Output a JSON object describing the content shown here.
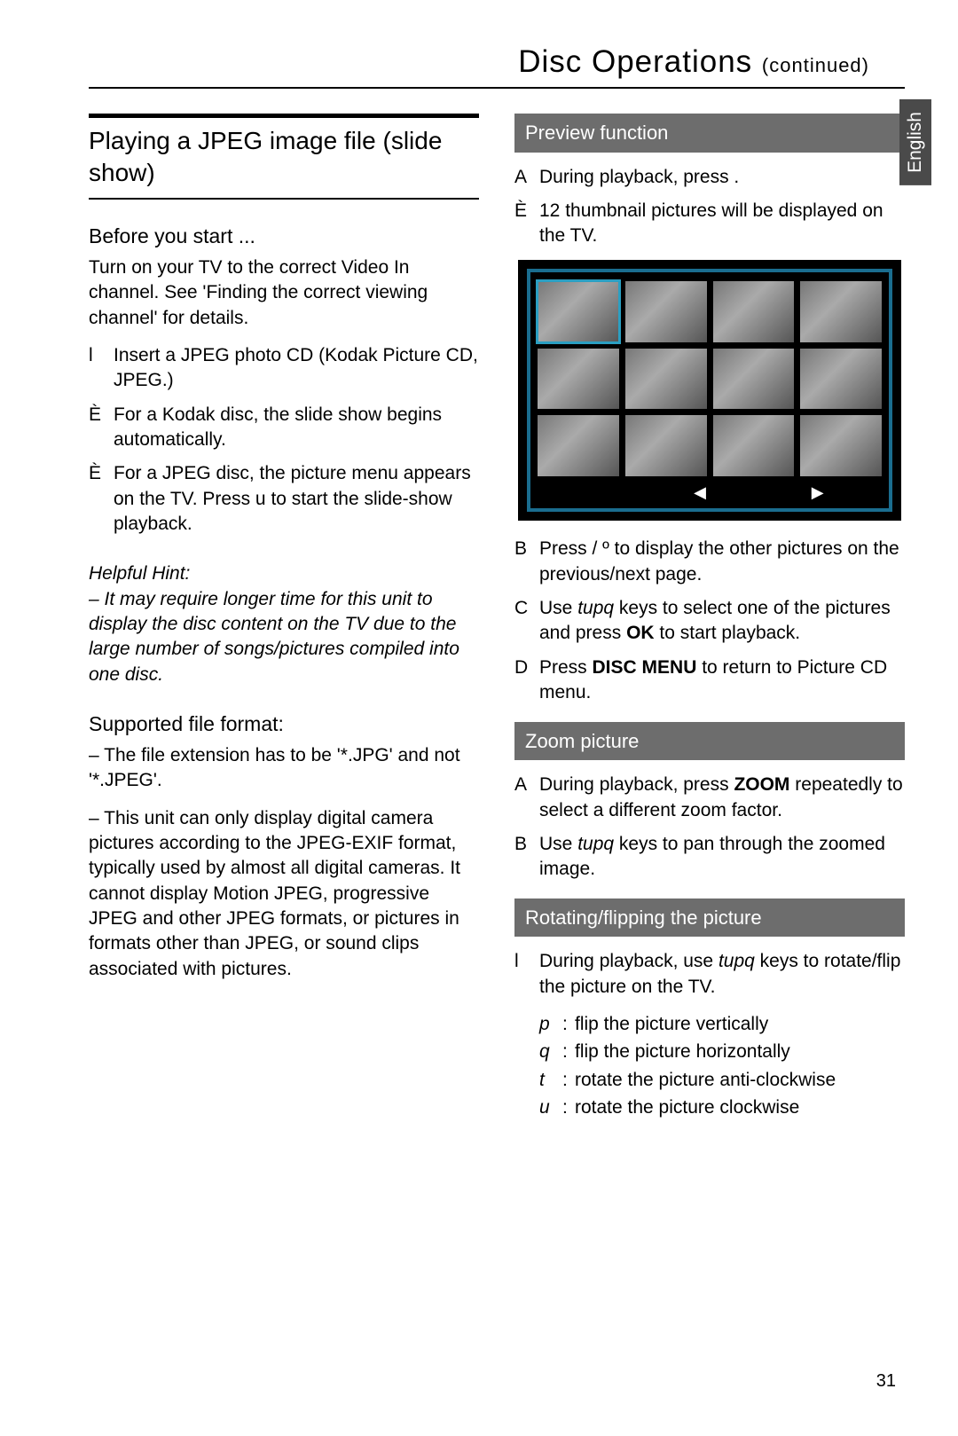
{
  "header": {
    "main": "Disc Operations ",
    "sub": "(continued)"
  },
  "lang": "English",
  "left": {
    "title": "Playing a JPEG image ﬁle (slide show)",
    "before_head": "Before you start ...",
    "before_body": "Turn on your TV to the correct Video In channel. See 'Finding the correct viewing channel' for details.",
    "insert_marker": "l",
    "insert": "Insert a JPEG photo CD (Kodak Picture CD, JPEG.)",
    "kodak_marker": "È",
    "kodak": "For a Kodak disc, the slide show begins automatically.",
    "jpeg_marker": "È",
    "jpeg": "For a JPEG disc, the picture menu appears on the TV. Press u  to start the slide-show playback.",
    "hint_head": "Helpful Hint:",
    "hint_body": "– It may require longer time for this unit to display the disc content on the TV due to the large number of songs/pictures compiled into one disc.",
    "fmt_head": "Supported ﬁle format:",
    "fmt1": "– The ﬁle extension has to be '*.JPG' and not '*.JPEG'.",
    "fmt2": "– This unit can only display digital camera pictures according to the JPEG-EXIF format, typically used by almost all digital cameras. It cannot display Motion JPEG, progressive JPEG and other JPEG formats, or pictures in formats other than JPEG, or sound clips associated with pictures."
  },
  "right": {
    "preview_bar": "Preview function",
    "p1_marker": "A",
    "p1": "During playback, press  .",
    "p1_sub_marker": "È",
    "p1_sub": "12 thumbnail pictures will be displayed on the TV.",
    "thumb_bottom": {
      "a": "",
      "b": "◀",
      "c": "",
      "d": "▶"
    },
    "p2_marker": "B",
    "p2": "Press  / º  to display the other pictures on the previous/next page.",
    "p3_marker": "C",
    "p3a": "Use ",
    "p3_keys": "tupq",
    "p3b": " keys to select one of the pictures and press ",
    "p3_ok": "OK",
    "p3c": " to start playback.",
    "p4_marker": "D",
    "p4a": "Press ",
    "p4_dm": "DISC MENU",
    "p4b": " to return to Picture CD menu.",
    "zoom_bar": "Zoom picture",
    "z1_marker": "A",
    "z1a": "During playback, press ",
    "z1_zoom": "ZOOM",
    "z1b": " repeatedly to select a different zoom factor.",
    "z2_marker": "B",
    "z2a": "Use ",
    "z2_keys": "tupq",
    "z2b": " keys to pan through the zoomed image.",
    "rot_bar": "Rotating/ﬂipping the picture",
    "r1_marker": "l",
    "r1a": "During playback, use ",
    "r1_keys": "tupq",
    "r1b": " keys to rotate/ﬂip the picture on the TV.",
    "keys": [
      {
        "k": "p",
        "t": "ﬂip the picture vertically"
      },
      {
        "k": "q",
        "t": "ﬂip the picture horizontally"
      },
      {
        "k": "t",
        "t": "rotate the picture anti-clockwise"
      },
      {
        "k": "u",
        "t": "rotate the picture clockwise"
      }
    ]
  },
  "pagenum": "31"
}
